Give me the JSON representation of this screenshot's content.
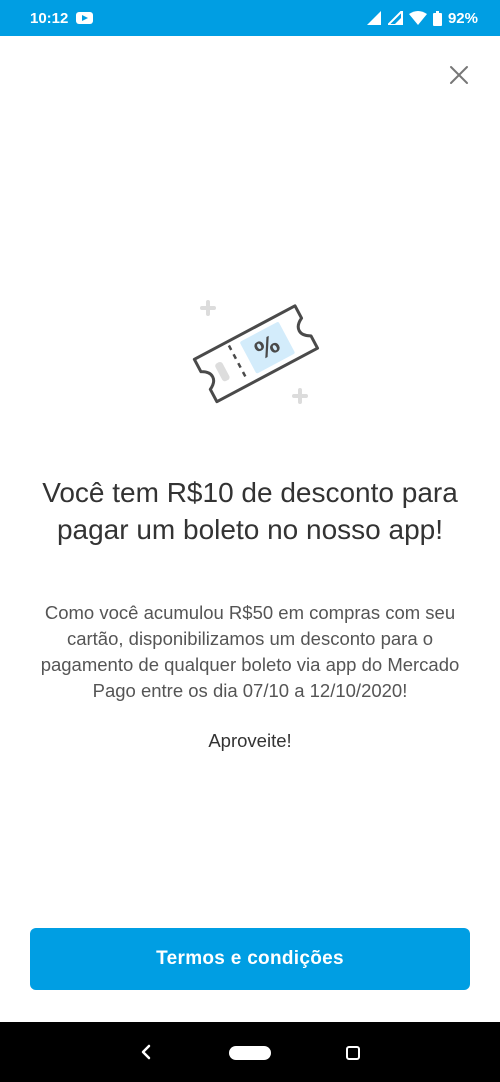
{
  "status_bar": {
    "time": "10:12",
    "battery": "92%",
    "icons": [
      "youtube-icon",
      "signal-icon",
      "signal-icon",
      "wifi-icon",
      "battery-icon"
    ]
  },
  "colors": {
    "brand": "#009ee3",
    "text_primary": "#333333",
    "text_secondary": "#555555"
  },
  "modal": {
    "close_icon": "close-icon",
    "illustration_icon": "discount-ticket-icon",
    "headline": "Você tem R$10 de desconto para pagar um boleto no nosso app!",
    "body": "Como você acumulou R$50 em compras com seu cartão, disponibilizamos um desconto para o pagamento de qualquer boleto via app do Mercado Pago entre os dia 07/10 a 12/10/2020!",
    "cta": "Aproveite!",
    "button_label": "Termos e condições"
  },
  "nav_bar": {
    "icons": [
      "back-icon",
      "home-pill-icon",
      "recents-icon"
    ]
  }
}
